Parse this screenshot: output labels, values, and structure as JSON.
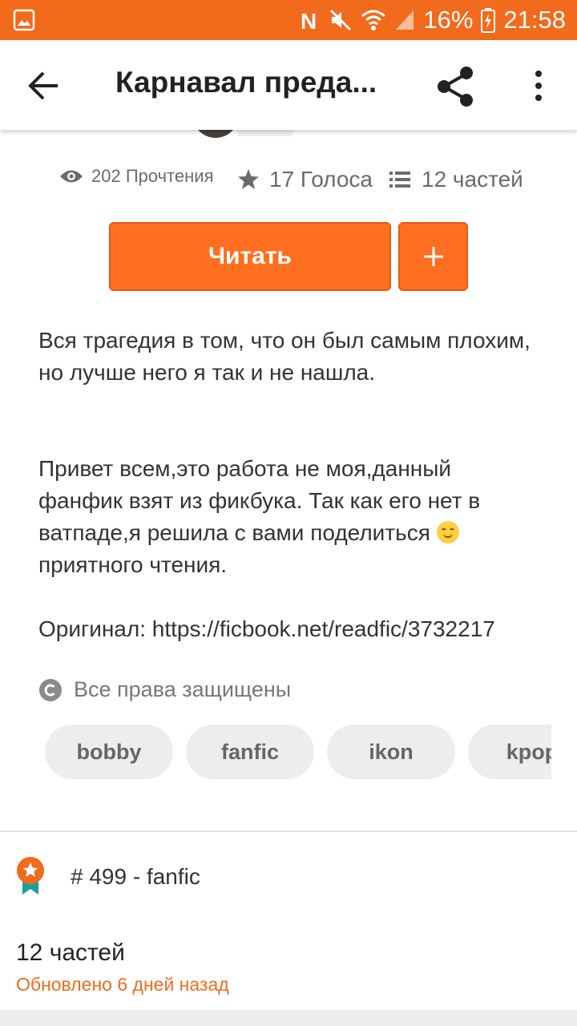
{
  "status_bar": {
    "battery": "16%",
    "time": "21:58",
    "icons": [
      "gallery-icon",
      "nfc-icon",
      "mute-icon",
      "wifi-icon",
      "signal-icon",
      "battery-icon"
    ]
  },
  "app_bar": {
    "title": "Карнавал преда...",
    "icons": [
      "back-arrow-icon",
      "share-icon",
      "more-vert-icon"
    ]
  },
  "stats": {
    "reads": "202 Прочтения",
    "votes": "17 Голоса",
    "parts": "12 частей"
  },
  "actions": {
    "read_label": "Читать",
    "add_label": "+"
  },
  "description": {
    "line1": "Вся трагедия в том, что он был самым плохим,",
    "line2": "но лучше него я так и не нашла.",
    "line3": "Привет всем,это работа не моя,данный",
    "line4": "фанфик взят из фикбука. Так как его нет в",
    "line5": "ватпаде,я решила с вами поделиться",
    "line6": "приятного чтения.",
    "line7": "Оригинал: https://ficbook.net/readfic/3732217"
  },
  "copyright": "Все права защищены",
  "tags": [
    "bobby",
    "fanfic",
    "ikon",
    "kpop"
  ],
  "ranking": "# 499 - fanfic",
  "parts_section": {
    "count": "12 частей",
    "updated": "Обновлено 6 дней назад"
  },
  "colors": {
    "accent": "#f26a1b",
    "button": "#ff6f1f",
    "tag_bg": "#ededed"
  }
}
